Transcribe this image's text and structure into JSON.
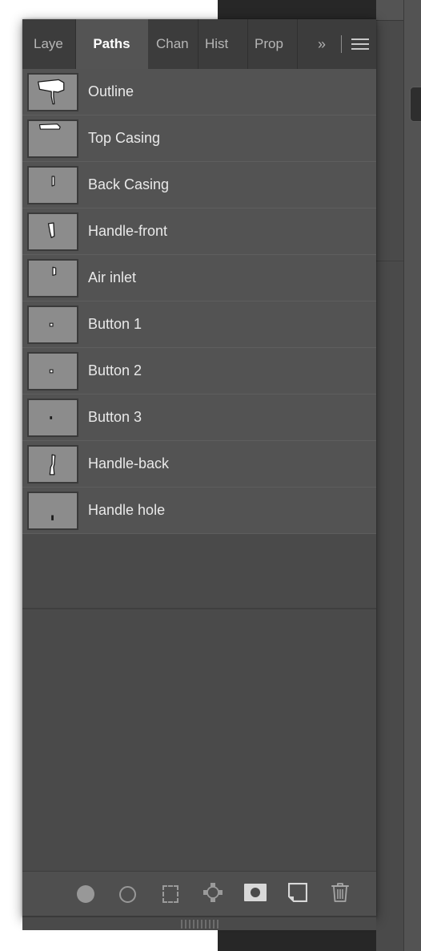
{
  "panel": {
    "title": "Paths",
    "tabs": [
      {
        "label": "Laye",
        "name": "layers",
        "active": false
      },
      {
        "label": "Paths",
        "name": "paths",
        "active": true
      },
      {
        "label": "Chan",
        "name": "channels",
        "active": false
      },
      {
        "label": "Hist",
        "name": "history",
        "active": false
      },
      {
        "label": "Prop",
        "name": "properties",
        "active": false
      }
    ],
    "overflow_label": "»",
    "menu_icon": "hamburger-menu-icon"
  },
  "paths": [
    {
      "name": "Outline",
      "thumb": "hairdryer-outline"
    },
    {
      "name": "Top Casing",
      "thumb": "top-casing-wedge"
    },
    {
      "name": "Back Casing",
      "thumb": "back-casing-sliver"
    },
    {
      "name": "Handle-front",
      "thumb": "handle-front-wedge"
    },
    {
      "name": "Air inlet",
      "thumb": "air-inlet-small"
    },
    {
      "name": "Button 1",
      "thumb": "button-dot-1"
    },
    {
      "name": "Button 2",
      "thumb": "button-dot-2"
    },
    {
      "name": "Button 3",
      "thumb": "button-dot-3"
    },
    {
      "name": "Handle-back",
      "thumb": "handle-back-strip"
    },
    {
      "name": "Handle hole",
      "thumb": "handle-hole-dot"
    }
  ],
  "toolbar": {
    "buttons": [
      {
        "name": "fill-path-with-foreground-color",
        "icon": "filled-circle-icon"
      },
      {
        "name": "stroke-path-with-brush",
        "icon": "circle-outline-icon"
      },
      {
        "name": "load-path-as-selection",
        "icon": "dashed-selection-icon"
      },
      {
        "name": "make-work-path-from-selection",
        "icon": "anchor-points-path-icon"
      },
      {
        "name": "add-layer-mask",
        "icon": "mask-icon"
      },
      {
        "name": "create-new-path",
        "icon": "new-page-icon"
      },
      {
        "name": "delete-current-path",
        "icon": "trash-icon"
      }
    ]
  },
  "colors": {
    "panel_bg": "#454545",
    "tab_inactive_bg": "#3c3c3c",
    "tab_active_bg": "#545454",
    "list_row_bg": "#535353",
    "list_empty_bg": "#4a4a4a",
    "toolbar_bg": "#4f4f4f",
    "text": "#e9e9e9",
    "thumbnail_bg": "#8c8c8c",
    "thumbnail_border": "#3a3a3a"
  }
}
